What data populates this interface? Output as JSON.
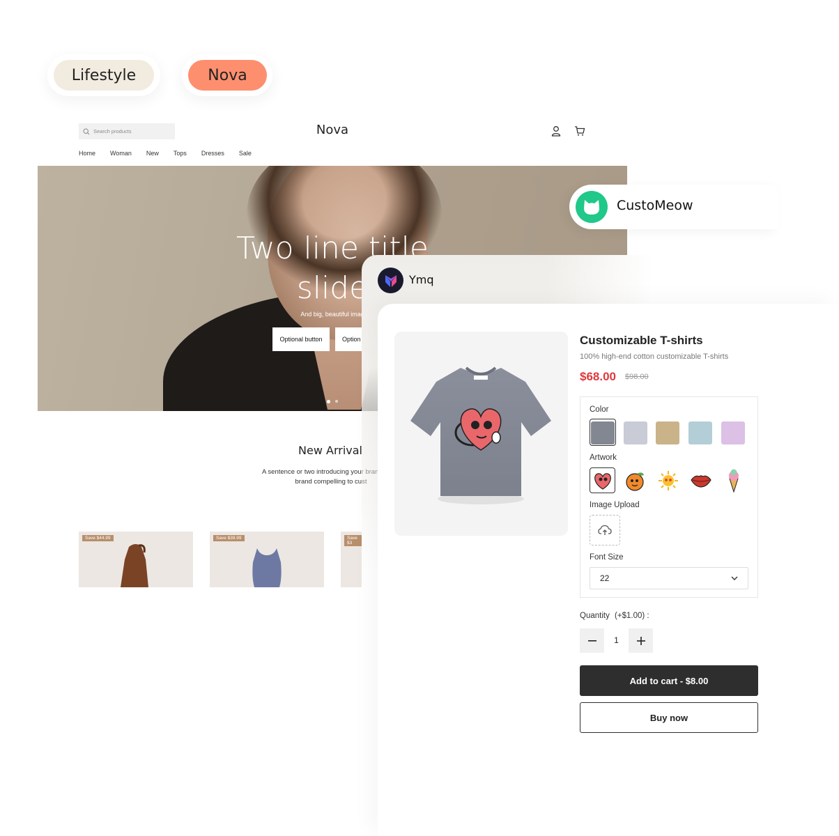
{
  "tags": {
    "lifestyle": "Lifestyle",
    "nova": "Nova"
  },
  "store": {
    "search_placeholder": "Search products",
    "brand": "Nova",
    "nav": [
      "Home",
      "Woman",
      "New",
      "Tops",
      "Dresses",
      "Sale"
    ],
    "hero": {
      "title_line1": "Two line title",
      "title_line2": "slide",
      "subtitle": "And big, beautiful imag",
      "button1": "Optional button",
      "button2": "Option"
    },
    "arrivals": {
      "title": "New Arrival",
      "desc_line1": "A sentence or two introducing your brand, what",
      "desc_line2": "brand compelling to cust"
    },
    "products": [
      {
        "badge": "Save $44.99"
      },
      {
        "badge": "Save $39.99"
      },
      {
        "badge": "Save $3"
      }
    ]
  },
  "customeow": {
    "name": "CustoMeow"
  },
  "ymq": {
    "name": "Ymq",
    "product": {
      "title": "Customizable T-shirts",
      "subtitle": "100% high-end cotton customizable T-shirts",
      "price": "$68.00",
      "old_price": "$98.00"
    },
    "options": {
      "color_label": "Color",
      "colors": [
        "#838792",
        "#c9cbd6",
        "#cbb389",
        "#b4ced7",
        "#dcc0e6"
      ],
      "artwork_label": "Artwork",
      "artworks": [
        "heart-artwork-icon",
        "orange-artwork-icon",
        "sun-artwork-icon",
        "lips-artwork-icon",
        "icecream-artwork-icon"
      ],
      "upload_label": "Image Upload",
      "font_size_label": "Font Size",
      "font_size_value": "22"
    },
    "quantity_label": "Quantity",
    "quantity_extra": "(+$1.00) :",
    "quantity_value": "1",
    "add_to_cart": "Add to cart - $8.00",
    "buy_now": "Buy now"
  },
  "colors": {
    "accent_red": "#e0393e",
    "green": "#20c889",
    "nova_pill": "#fd8f6f",
    "lifestyle_pill": "#f2ebdf"
  }
}
